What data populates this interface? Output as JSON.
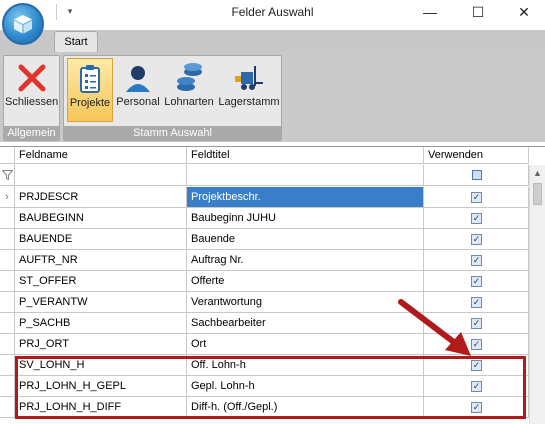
{
  "window": {
    "title": "Felder Auswahl",
    "minimize": "—",
    "maximize": "☐",
    "close": "✕",
    "qat_icon": "▾"
  },
  "ribbon": {
    "tab": "Start",
    "groups": [
      {
        "label": "Allgemein"
      },
      {
        "label": "Stamm Auswahl"
      }
    ],
    "buttons": {
      "close": "Schliessen",
      "projects": "Projekte",
      "staff": "Personal",
      "wage": "Lohnarten",
      "warehouse": "Lagerstamm"
    }
  },
  "grid": {
    "columns": [
      "Feldname",
      "Feldtitel",
      "Verwenden"
    ],
    "rows": [
      {
        "name": "PRJDESCR",
        "title": "Projektbeschr.",
        "use": "✓"
      },
      {
        "name": "BAUBEGINN",
        "title": "Baubeginn JUHU",
        "use": "✓"
      },
      {
        "name": "BAUENDE",
        "title": "Bauende",
        "use": "✓"
      },
      {
        "name": "AUFTR_NR",
        "title": "Auftrag Nr.",
        "use": "✓"
      },
      {
        "name": "ST_OFFER",
        "title": "Offerte",
        "use": "✓"
      },
      {
        "name": "P_VERANTW",
        "title": "Verantwortung",
        "use": "✓"
      },
      {
        "name": "P_SACHB",
        "title": "Sachbearbeiter",
        "use": "✓"
      },
      {
        "name": "PRJ_ORT",
        "title": "Ort",
        "use": "✓"
      },
      {
        "name": "SV_LOHN_H",
        "title": "Off. Lohn-h",
        "use": "✓"
      },
      {
        "name": "PRJ_LOHN_H_GEPL",
        "title": "Gepl. Lohn-h",
        "use": "✓"
      },
      {
        "name": "PRJ_LOHN_H_DIFF",
        "title": "Diff-h. (Off./Gepl.)",
        "use": "✓"
      }
    ],
    "current_row_marker": "›",
    "scroll_up": "▲"
  },
  "colors": {
    "selection": "#3a7dc8",
    "highlight": "#b01a1a",
    "active_button": "#f6c65a"
  }
}
